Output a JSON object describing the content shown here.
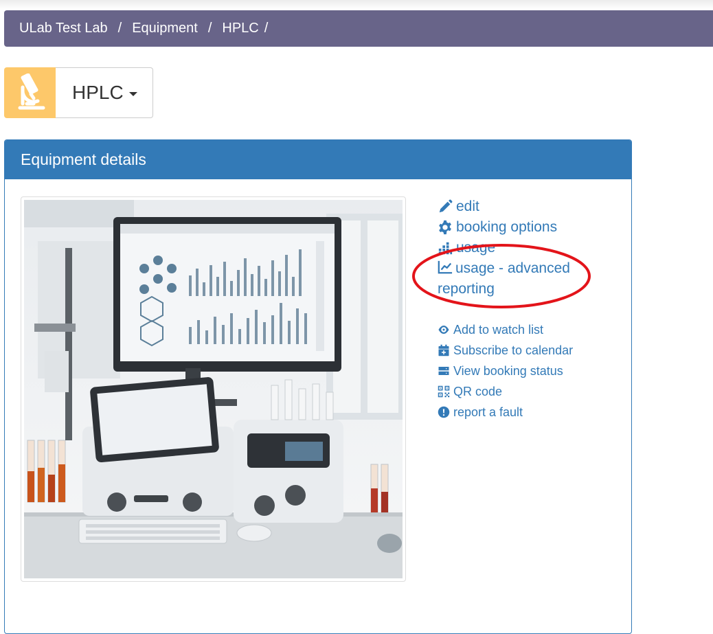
{
  "colors": {
    "breadcrumb_bg": "#686489",
    "panel_primary": "#337ab7",
    "link": "#337ab7",
    "icon_box_bg": "#fdc86a",
    "highlight": "#e3141a"
  },
  "breadcrumb": {
    "items": [
      "ULab Test Lab",
      "Equipment",
      "HPLC"
    ],
    "separator": "/"
  },
  "equipment_selector": {
    "icon": "microscope-icon",
    "name": "HPLC"
  },
  "panel": {
    "title": "Equipment details"
  },
  "photo": {
    "description_icon": "hplc-instrument-photo"
  },
  "actions": {
    "edit": {
      "label": "edit",
      "icon": "pencil-icon"
    },
    "booking_options": {
      "label": "booking options",
      "icon": "gear-icon"
    },
    "usage": {
      "label": "usage",
      "icon": "bar-chart-icon"
    },
    "usage_advanced": {
      "label": "usage - advanced reporting",
      "icon": "line-chart-icon"
    }
  },
  "secondary_actions": {
    "watch": {
      "label": "Add to watch list",
      "icon": "eye-icon"
    },
    "subscribe": {
      "label": "Subscribe to calendar",
      "icon": "calendar-plus-icon"
    },
    "status": {
      "label": "View booking status",
      "icon": "server-icon"
    },
    "qr": {
      "label": "QR code",
      "icon": "qrcode-icon"
    },
    "fault": {
      "label": "report a fault",
      "icon": "exclamation-circle-icon"
    }
  }
}
